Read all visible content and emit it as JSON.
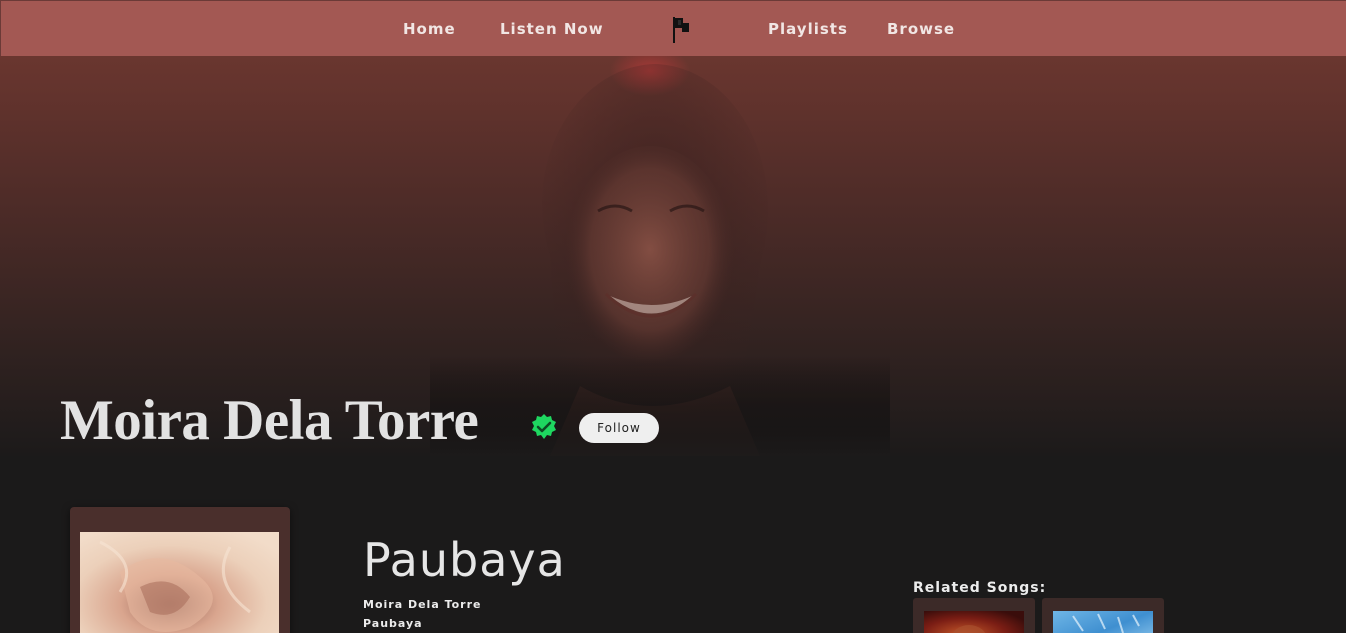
{
  "nav": {
    "items": [
      {
        "label": "Home"
      },
      {
        "label": "Listen Now"
      },
      {
        "label": "Playlists"
      },
      {
        "label": "Browse"
      }
    ],
    "logo_icon": "flag-icon"
  },
  "artist": {
    "name": "Moira Dela Torre",
    "verified_icon": "verified-badge-icon",
    "follow_label": "Follow"
  },
  "song": {
    "title": "Paubaya",
    "artist": "Moira Dela Torre",
    "album": "Paubaya"
  },
  "related": {
    "heading": "Related Songs:"
  },
  "colors": {
    "nav_bg": "#a35853",
    "page_bg": "#1b1a1a",
    "card_bg": "#4a2f2c",
    "verified": "#1ed760"
  }
}
